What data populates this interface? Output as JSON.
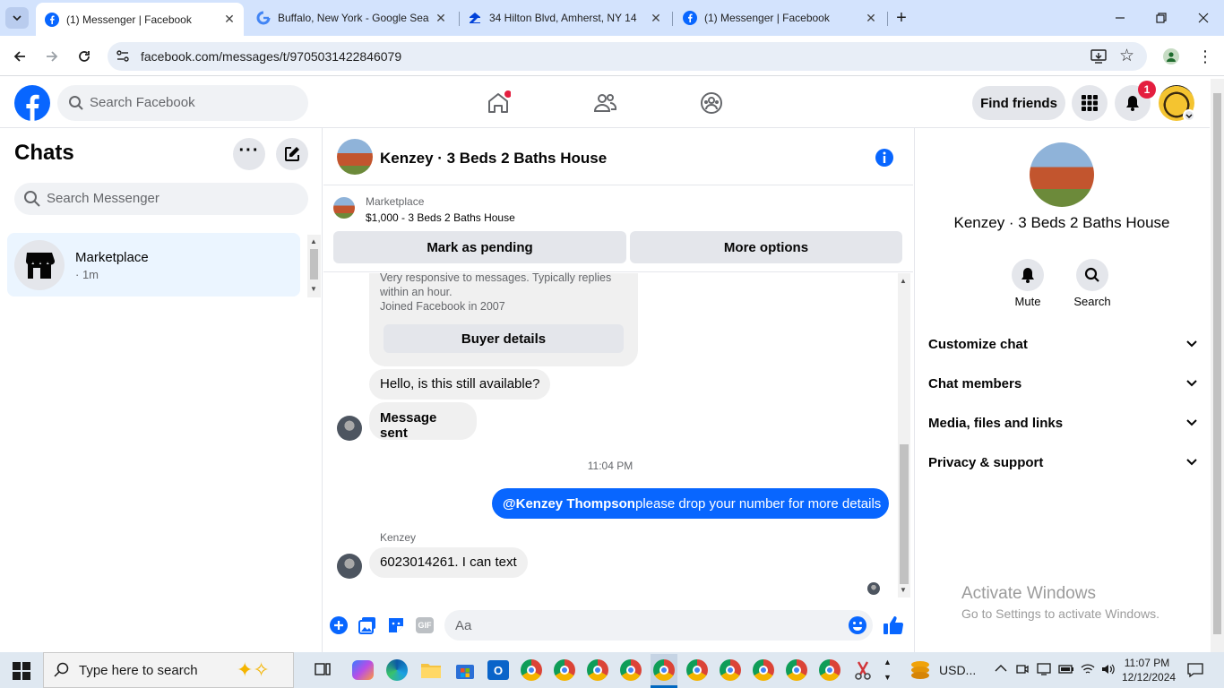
{
  "browser": {
    "tabs": [
      {
        "title": "(1) Messenger | Facebook",
        "favicon": "facebook-icon"
      },
      {
        "title": "Buffalo, New York - Google Sea",
        "favicon": "google-icon"
      },
      {
        "title": "34 Hilton Blvd, Amherst, NY 14",
        "favicon": "zillow-icon"
      },
      {
        "title": "(1) Messenger | Facebook",
        "favicon": "facebook-icon"
      }
    ],
    "url": "facebook.com/messages/t/9705031422846079"
  },
  "fb_header": {
    "search_placeholder": "Search Facebook",
    "find_friends": "Find friends",
    "notification_count": "1"
  },
  "left": {
    "title": "Chats",
    "search_placeholder": "Search Messenger",
    "chats": [
      {
        "name": "Marketplace",
        "meta": "· 1m"
      }
    ]
  },
  "chat": {
    "title": "Kenzey · 3 Beds 2 Baths House",
    "listing_label": "Marketplace",
    "listing_title": "$1,000 - 3 Beds 2 Baths House",
    "mark_pending": "Mark as pending",
    "more_options": "More options",
    "buyer_info_line1": "Very responsive to messages. Typically replies",
    "buyer_info_line2": "within an hour.",
    "buyer_info_line3": "Joined Facebook in 2007",
    "buyer_details": "Buyer details",
    "msg_available": "Hello, is this still available?",
    "msg_sent": "Message sent",
    "timestamp": "11:04 PM",
    "outgoing_mention": "@Kenzey Thompson",
    "outgoing_text": " please drop your number for more details",
    "sender_name": "Kenzey",
    "incoming_reply": "6023014261. I can text",
    "composer_placeholder": "Aa",
    "accent": "#0866ff"
  },
  "right": {
    "name": "Kenzey · 3 Beds 2 Baths House",
    "mute": "Mute",
    "search": "Search",
    "sections": [
      "Customize chat",
      "Chat members",
      "Media, files and links",
      "Privacy & support"
    ],
    "watermark_title": "Activate Windows",
    "watermark_sub": "Go to Settings to activate Windows."
  },
  "taskbar": {
    "search_placeholder": "Type here to search",
    "currency": "USD...",
    "time": "11:07 PM",
    "date": "12/12/2024"
  }
}
